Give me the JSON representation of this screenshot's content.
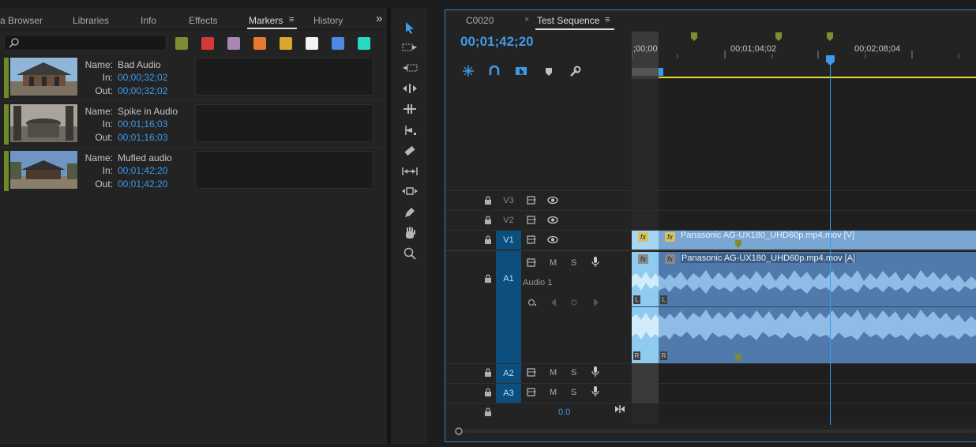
{
  "markers_panel": {
    "tabs": [
      "a Browser",
      "Libraries",
      "Info",
      "Effects",
      "Markers",
      "History"
    ],
    "active_tab": "Markers",
    "overflow_label": "»",
    "menu_icon": "≡",
    "search_placeholder": "",
    "color_swatches": [
      "#7c8e31",
      "#d43838",
      "#a887b5",
      "#e57a2e",
      "#d8a72e",
      "#f4f4f4",
      "#4a8ae2",
      "#28d9c1"
    ],
    "labels": {
      "name": "Name:",
      "in": "In:",
      "out": "Out:"
    },
    "markers": [
      {
        "name": "Bad Audio",
        "in": "00;00;32;02",
        "out": "00;00;32;02"
      },
      {
        "name": "Spike in Audio",
        "in": "00;01;16;03",
        "out": "00;01;16;03"
      },
      {
        "name": "Mufled audio",
        "in": "00;01;42;20",
        "out": "00;01;42;20"
      }
    ]
  },
  "tools": [
    "selection-tool",
    "track-select-forward-tool",
    "track-select-backward-tool",
    "ripple-edit-tool",
    "rolling-edit-tool",
    "rate-stretch-tool",
    "razor-tool",
    "slip-tool",
    "slide-tool",
    "pen-tool",
    "hand-tool",
    "zoom-tool"
  ],
  "timeline": {
    "tabs": [
      {
        "label": "C0020",
        "close": ""
      },
      {
        "label": "Test Sequence",
        "close": "×"
      }
    ],
    "menu_icon": "≡",
    "timecode": "00;01;42;20",
    "ruler_labels": [
      ";00;00",
      "00;01;04;02",
      "00;02;08;04"
    ],
    "tracks": {
      "video": [
        "V3",
        "V2",
        "V1"
      ],
      "audio": [
        "A1",
        "A2",
        "A3"
      ],
      "audio1_name": "Audio 1",
      "mute": "M",
      "solo": "S",
      "master_volume": "0.0"
    },
    "clips": {
      "video_title": "Panasonic AG-UX180_UHD60p.mp4.mov [V]",
      "audio_title": "Panasonic AG-UX180_UHD60p.mp4.mov [A]",
      "fx_label": "fx",
      "left_channel": "L",
      "right_channel": "R"
    },
    "colors": {
      "accent": "#3d9be9",
      "target_track": "#0c4f7f",
      "video_clip": "#79a6d3",
      "audio_clip": "#4f7aab",
      "marker": "#7c8e31"
    }
  }
}
